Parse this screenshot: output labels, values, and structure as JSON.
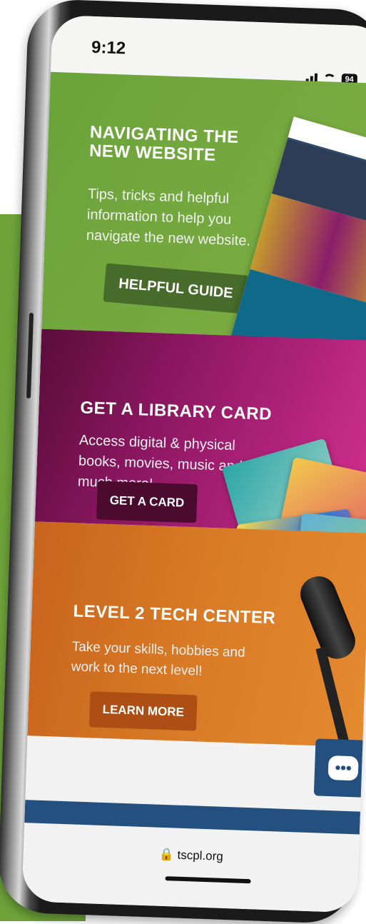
{
  "status": {
    "time": "9:12",
    "battery": "94"
  },
  "sections": [
    {
      "title": "NAVIGATING THE NEW WEBSITE",
      "description": "Tips, tricks and helpful information to help you navigate the new website.",
      "button": "HELPFUL GUIDE",
      "color": "#6aa33a"
    },
    {
      "title": "GET A LIBRARY CARD",
      "description": "Access digital & physical books, movies, music and so much more!",
      "button": "GET A CARD",
      "color": "#a1206f"
    },
    {
      "title": "LEVEL 2 TECH CENTER",
      "description": "Take your skills, hobbies and work to the next level!",
      "button": "LEARN MORE",
      "color": "#d97b26"
    }
  ],
  "chat": {
    "icon": "chat-icon",
    "glyph": "•••"
  },
  "address_bar": {
    "url": "tscpl.org",
    "icon": "lock-icon"
  }
}
